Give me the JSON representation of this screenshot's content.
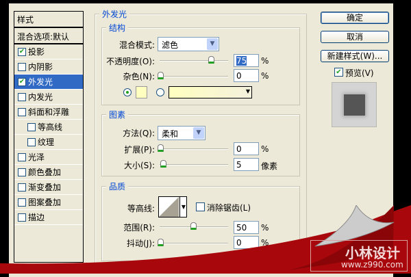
{
  "sidebar": {
    "header": "样式",
    "blend": "混合选项:默认",
    "items": [
      {
        "label": "投影",
        "checked": true
      },
      {
        "label": "内阴影",
        "checked": false
      },
      {
        "label": "外发光",
        "checked": true,
        "selected": true
      },
      {
        "label": "内发光",
        "checked": false
      },
      {
        "label": "斜面和浮雕",
        "checked": false
      },
      {
        "label": "等高线",
        "checked": false,
        "sub": true
      },
      {
        "label": "纹理",
        "checked": false,
        "sub": true
      },
      {
        "label": "光泽",
        "checked": false
      },
      {
        "label": "颜色叠加",
        "checked": false
      },
      {
        "label": "渐变叠加",
        "checked": false
      },
      {
        "label": "图案叠加",
        "checked": false
      },
      {
        "label": "描边",
        "checked": false
      }
    ]
  },
  "panel": {
    "title": "外发光",
    "structure": {
      "title": "结构",
      "blend_mode_label": "混合模式:",
      "blend_mode": "滤色",
      "opacity_label": "不透明度(O):",
      "opacity": "75",
      "noise_label": "杂色(N):",
      "noise": "0",
      "pct": "%",
      "glow_color": "#ffffc0"
    },
    "elements": {
      "title": "图素",
      "method_label": "方法(Q):",
      "method": "柔和",
      "spread_label": "扩展(P):",
      "spread": "0",
      "size_label": "大小(S):",
      "size": "5",
      "pct": "%",
      "px": "像素"
    },
    "quality": {
      "title": "品质",
      "contour_label": "等高线:",
      "antialias_label": "消除锯齿(L)",
      "range_label": "范围(R):",
      "range": "50",
      "jitter_label": "抖动(J):",
      "jitter": "0",
      "pct": "%"
    }
  },
  "buttons": {
    "ok": "确定",
    "cancel": "取消",
    "new_style": "新建样式(W)...",
    "preview": "预览(V)"
  },
  "watermark": {
    "name": "小林设计",
    "url": "www.z990.com"
  }
}
